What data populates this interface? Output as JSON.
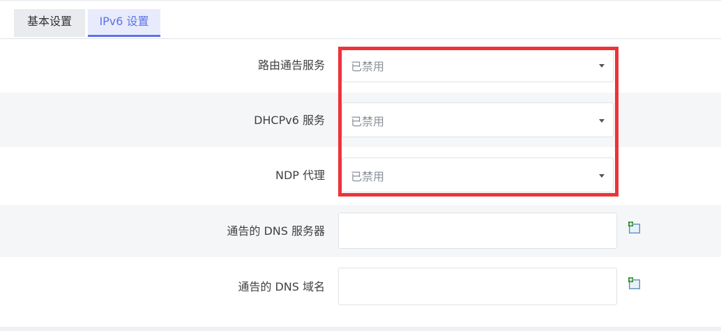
{
  "tabs": [
    {
      "label": "基本设置",
      "active": false
    },
    {
      "label": "IPv6 设置",
      "active": true
    }
  ],
  "fields": {
    "ra_service": {
      "label": "路由通告服务",
      "value": "已禁用"
    },
    "dhcpv6_service": {
      "label": "DHCPv6 服务",
      "value": "已禁用"
    },
    "ndp_proxy": {
      "label": "NDP 代理",
      "value": "已禁用"
    },
    "dns_servers": {
      "label": "通告的 DNS 服务器",
      "value": ""
    },
    "dns_domains": {
      "label": "通告的 DNS 域名",
      "value": ""
    }
  },
  "icons": {
    "add": "add-entry-icon"
  },
  "colors": {
    "accent": "#5e72e4",
    "highlight": "#ee3338"
  }
}
